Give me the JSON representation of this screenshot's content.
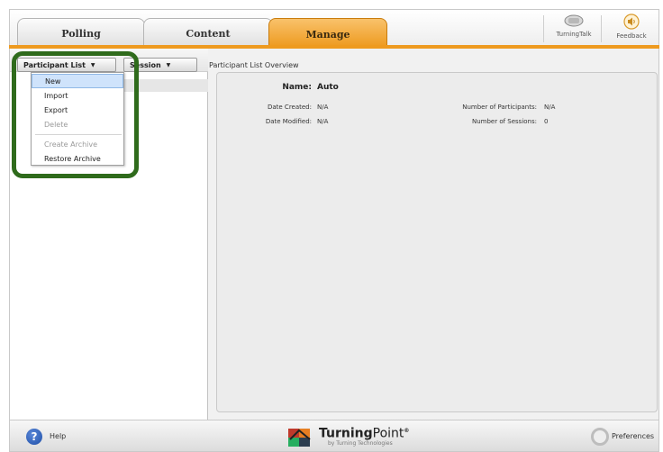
{
  "tabs": [
    {
      "label": "Polling",
      "active": false
    },
    {
      "label": "Content",
      "active": false
    },
    {
      "label": "Manage",
      "active": true
    }
  ],
  "toolbar_icons": {
    "turningtalk_label": "TurningTalk",
    "feedback_label": "Feedback"
  },
  "left_toolbar": {
    "participant_list_label": "Participant List",
    "session_label": "Session"
  },
  "dropdown_menu": {
    "items": [
      {
        "label": "New",
        "state": "highlighted"
      },
      {
        "label": "Import",
        "state": "enabled"
      },
      {
        "label": "Export",
        "state": "enabled"
      },
      {
        "label": "Delete",
        "state": "disabled"
      },
      {
        "label": "Create Archive",
        "state": "disabled"
      },
      {
        "label": "Restore Archive",
        "state": "enabled"
      }
    ]
  },
  "overview": {
    "title": "Participant List Overview",
    "name_label": "Name:",
    "name_value": "Auto",
    "date_created_label": "Date Created:",
    "date_created_value": "N/A",
    "date_modified_label": "Date Modified:",
    "date_modified_value": "N/A",
    "num_participants_label": "Number of Participants:",
    "num_participants_value": "N/A",
    "num_sessions_label": "Number of Sessions:",
    "num_sessions_value": "0"
  },
  "bottom_bar": {
    "help_label": "Help",
    "logo_name_bold": "Turning",
    "logo_name_light": "Point",
    "logo_trademark": "®",
    "logo_sub": "by Turning Technologies",
    "preferences_label": "Preferences"
  },
  "colors": {
    "accent_orange": "#ee9a1f",
    "highlight_green": "#2f6b1c",
    "menu_selected": "#cfe3fb"
  }
}
